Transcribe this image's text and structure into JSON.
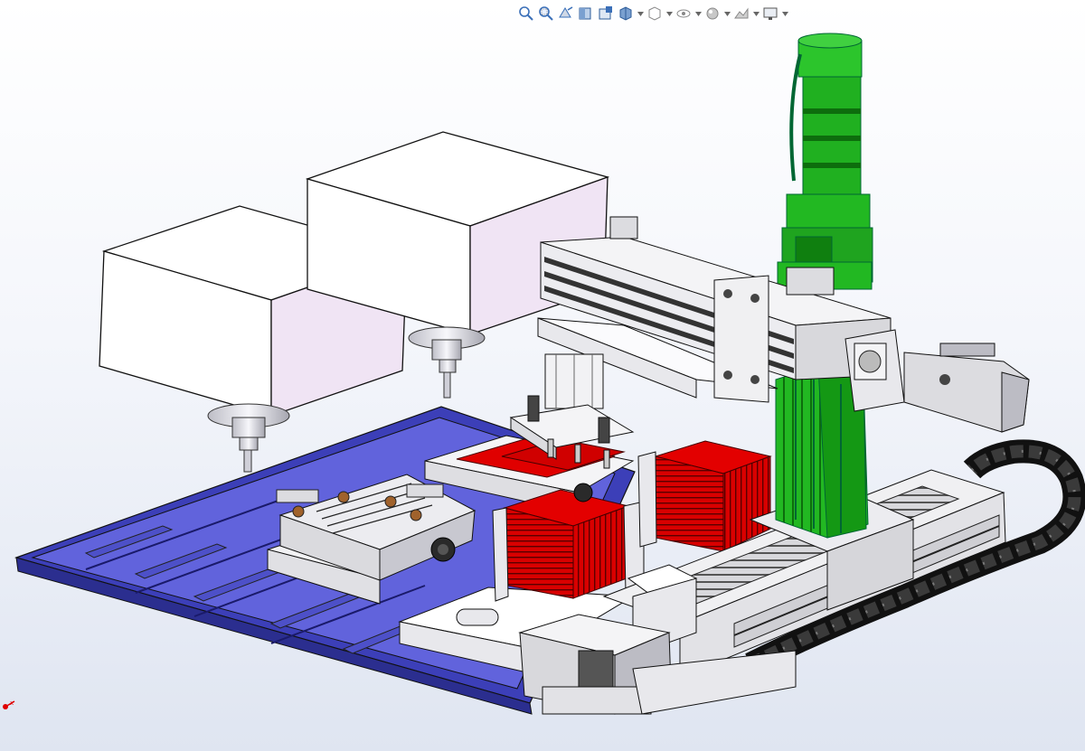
{
  "toolbar": {
    "buttons": [
      {
        "name": "zoom-to-fit-icon"
      },
      {
        "name": "zoom-to-area-icon"
      },
      {
        "name": "previous-view-icon"
      },
      {
        "name": "section-view-icon"
      },
      {
        "name": "dynamic-annotation-icon"
      },
      {
        "name": "view-orientation-icon",
        "dropdown": true
      },
      {
        "name": "display-style-icon",
        "dropdown": true
      },
      {
        "name": "hide-show-items-icon",
        "dropdown": true
      },
      {
        "name": "edit-appearance-icon",
        "dropdown": true
      },
      {
        "name": "apply-scene-icon",
        "dropdown": true
      },
      {
        "name": "view-settings-icon",
        "dropdown": true
      }
    ]
  },
  "colors": {
    "base_plate": "#5b5ed6",
    "motor_green": "#1fb21f",
    "red_parts": "#e30000",
    "aluminium": "#e6e6ea",
    "cable_chain": "#1a1a1a",
    "laser_head": "#f7f3fb",
    "axis_x": "#e00000"
  }
}
